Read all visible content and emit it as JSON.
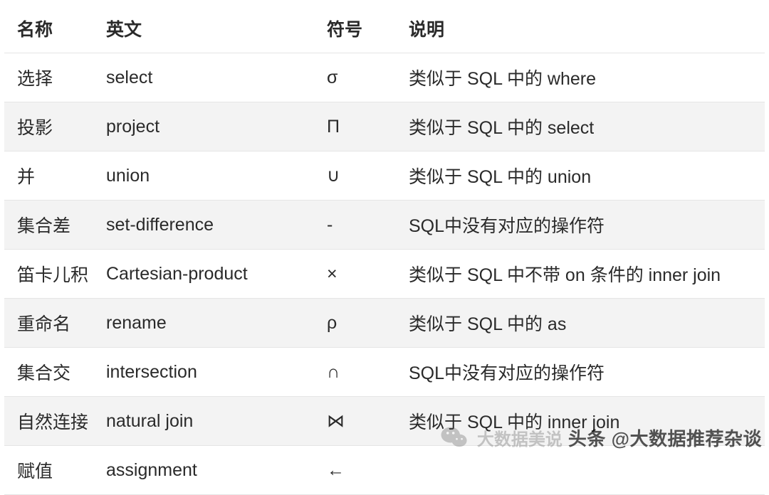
{
  "table": {
    "headers": {
      "name": "名称",
      "english": "英文",
      "symbol": "符号",
      "desc": "说明"
    },
    "rows": [
      {
        "name": "选择",
        "english": "select",
        "symbol": "σ",
        "desc": "类似于 SQL 中的 where"
      },
      {
        "name": "投影",
        "english": "project",
        "symbol": "Π",
        "desc": "类似于 SQL 中的 select"
      },
      {
        "name": "并",
        "english": "union",
        "symbol": "∪",
        "desc": "类似于 SQL 中的 union"
      },
      {
        "name": "集合差",
        "english": "set-difference",
        "symbol": "-",
        "desc": "SQL中没有对应的操作符"
      },
      {
        "name": "笛卡儿积",
        "english": "Cartesian-product",
        "symbol": "×",
        "desc": "类似于 SQL 中不带 on 条件的 inner join"
      },
      {
        "name": "重命名",
        "english": "rename",
        "symbol": "ρ",
        "desc": "类似于 SQL 中的 as"
      },
      {
        "name": "集合交",
        "english": "intersection",
        "symbol": "∩",
        "desc": "SQL中没有对应的操作符"
      },
      {
        "name": "自然连接",
        "english": "natural join",
        "symbol": "⋈",
        "desc": "类似于 SQL 中的 inner join"
      },
      {
        "name": "赋值",
        "english": "assignment",
        "symbol": "←",
        "desc": ""
      }
    ]
  },
  "watermark": {
    "faded_text": "大数据美说",
    "source": "头条 @大数据推荐杂谈"
  }
}
